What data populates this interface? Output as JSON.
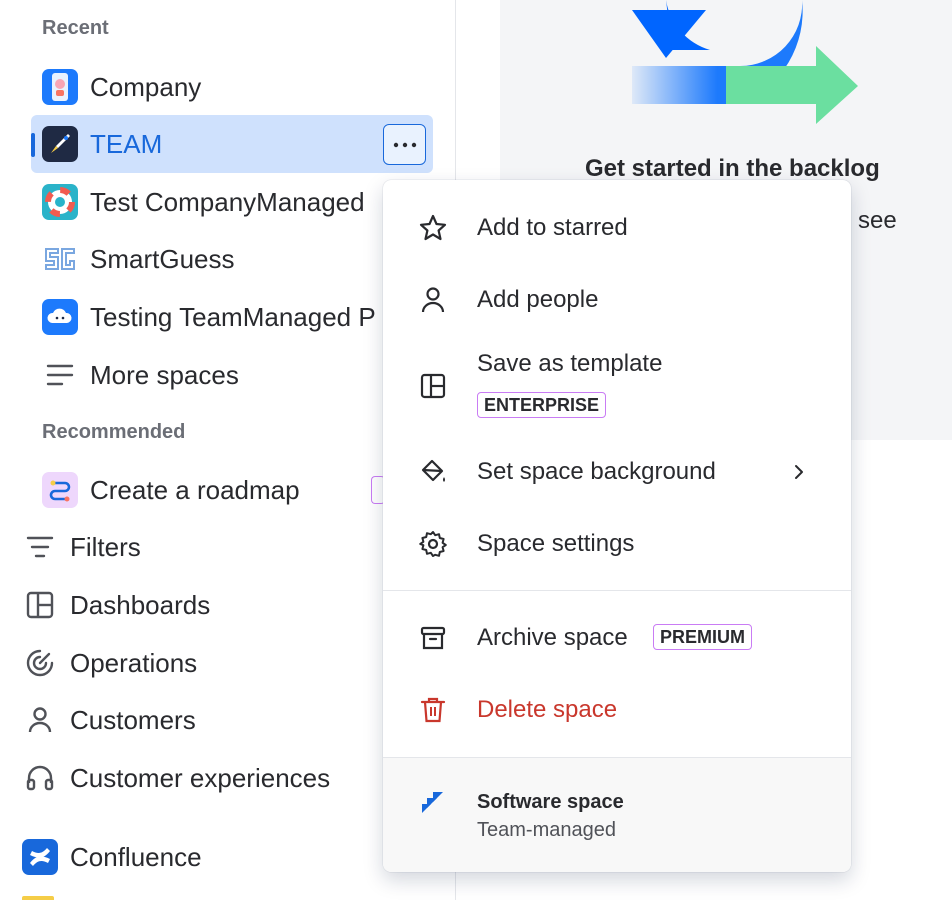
{
  "sidebar": {
    "recent_heading": "Recent",
    "recent": [
      {
        "label": "Company",
        "icon": "phone-avatar-icon"
      },
      {
        "label": "TEAM",
        "icon": "rocket-avatar-icon",
        "selected": true
      },
      {
        "label": "Test CompanyManaged",
        "icon": "lifebuoy-avatar-icon"
      },
      {
        "label": "SmartGuess",
        "icon": "sg-logo-icon"
      },
      {
        "label": "Testing TeamManaged P",
        "icon": "cloud-avatar-icon"
      }
    ],
    "more_spaces": "More spaces",
    "recommended_heading": "Recommended",
    "recommended": [
      {
        "label": "Create a roadmap",
        "icon": "roadmap-icon"
      }
    ],
    "top_level": [
      {
        "label": "Filters",
        "icon": "filter-icon"
      },
      {
        "label": "Dashboards",
        "icon": "dashboard-icon"
      },
      {
        "label": "Operations",
        "icon": "operations-icon"
      },
      {
        "label": "Customers",
        "icon": "person-icon"
      },
      {
        "label": "Customer experiences",
        "icon": "headphones-icon"
      },
      {
        "label": "Confluence",
        "icon": "confluence-logo-icon"
      }
    ]
  },
  "main": {
    "empty_title": "Get started in the backlog",
    "empty_desc_fragment": "o see"
  },
  "menu": {
    "items": [
      {
        "label": "Add to starred",
        "icon": "star-icon"
      },
      {
        "label": "Add people",
        "icon": "person-icon"
      },
      {
        "label": "Save as template",
        "icon": "template-icon",
        "badge": "ENTERPRISE"
      },
      {
        "label": "Set space background",
        "icon": "paint-bucket-icon"
      },
      {
        "label": "Space settings",
        "icon": "gear-icon"
      },
      {
        "label": "Archive space",
        "icon": "archive-icon",
        "badge": "PREMIUM"
      },
      {
        "label": "Delete space",
        "icon": "trash-icon"
      }
    ],
    "footer": {
      "title": "Software space",
      "subtitle": "Team-managed",
      "icon": "jira-software-icon"
    }
  },
  "colors": {
    "accent": "#1868db",
    "selected_bg": "#cfe1fd",
    "danger": "#c9372c",
    "badge_border": "#c97cf4"
  }
}
